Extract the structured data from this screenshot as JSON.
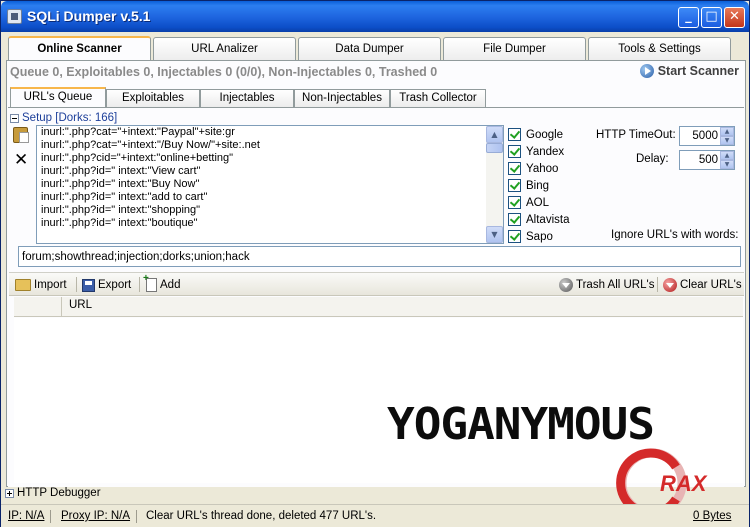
{
  "window": {
    "title": "SQLi Dumper v.5.1",
    "minimize": "_",
    "maximize": "□",
    "close": "✕"
  },
  "main_tabs": [
    {
      "label": "Online Scanner",
      "active": true
    },
    {
      "label": "URL Analizer",
      "active": false
    },
    {
      "label": "Data Dumper",
      "active": false
    },
    {
      "label": "File Dumper",
      "active": false
    },
    {
      "label": "Tools & Settings",
      "active": false
    }
  ],
  "queue_status": "Queue 0, Exploitables 0, Injectables 0 (0/0), Non-Injectables 0, Trashed 0",
  "start_scanner": {
    "label": "Start Scanner",
    "icon": "play-circle-icon"
  },
  "sub_tabs": [
    {
      "label": "URL's Queue",
      "active": true
    },
    {
      "label": "Exploitables",
      "active": false
    },
    {
      "label": "Injectables",
      "active": false
    },
    {
      "label": "Non-Injectables",
      "active": false
    },
    {
      "label": "Trash Collector",
      "active": false
    }
  ],
  "setup_label": "Setup [Dorks: 166]",
  "dorks": [
    "inurl:\".php?cat=\"+intext:\"Paypal\"+site:gr",
    "inurl:\".php?cat=\"+intext:\"/Buy Now/\"+site:.net",
    "inurl:\".php?cid=\"+intext:\"online+betting\"",
    "inurl:\".php?id=\" intext:\"View cart\"",
    "inurl:\".php?id=\" intext:\"Buy Now\"",
    "inurl:\".php?id=\" intext:\"add to cart\"",
    "inurl:\".php?id=\" intext:\"shopping\"",
    "inurl:\".php?id=\" intext:\"boutique\""
  ],
  "search_engines": [
    {
      "label": "Google",
      "checked": true
    },
    {
      "label": "Yandex",
      "checked": true
    },
    {
      "label": "Yahoo",
      "checked": true
    },
    {
      "label": "Bing",
      "checked": true
    },
    {
      "label": "AOL",
      "checked": true
    },
    {
      "label": "Altavista",
      "checked": true
    },
    {
      "label": "Sapo",
      "checked": true
    }
  ],
  "settings": {
    "http_timeout_label": "HTTP TimeOut:",
    "http_timeout_value": "5000",
    "delay_label": "Delay:",
    "delay_value": "500",
    "ignore_label": "Ignore URL's with words:",
    "ignore_value": "forum;showthread;injection;dorks;union;hack"
  },
  "toolbar": {
    "import": "Import",
    "export": "Export",
    "add": "Add",
    "trash_all": "Trash All URL's",
    "clear": "Clear URL's"
  },
  "grid": {
    "url_header": "URL"
  },
  "watermark": "YOGANYMOUS",
  "http_debugger": "HTTP Debugger",
  "statusbar": {
    "ip": "IP: N/A",
    "proxy_ip": "Proxy IP: N/A",
    "message": "Clear URL's thread done, deleted 477 URL's.",
    "bytes": "0 Bytes"
  },
  "crax_logo": "RAX",
  "colors": {
    "title_blue": "#1f66e0",
    "tab_highlight": "#f7b64b",
    "crax_red": "#d42a2a"
  }
}
